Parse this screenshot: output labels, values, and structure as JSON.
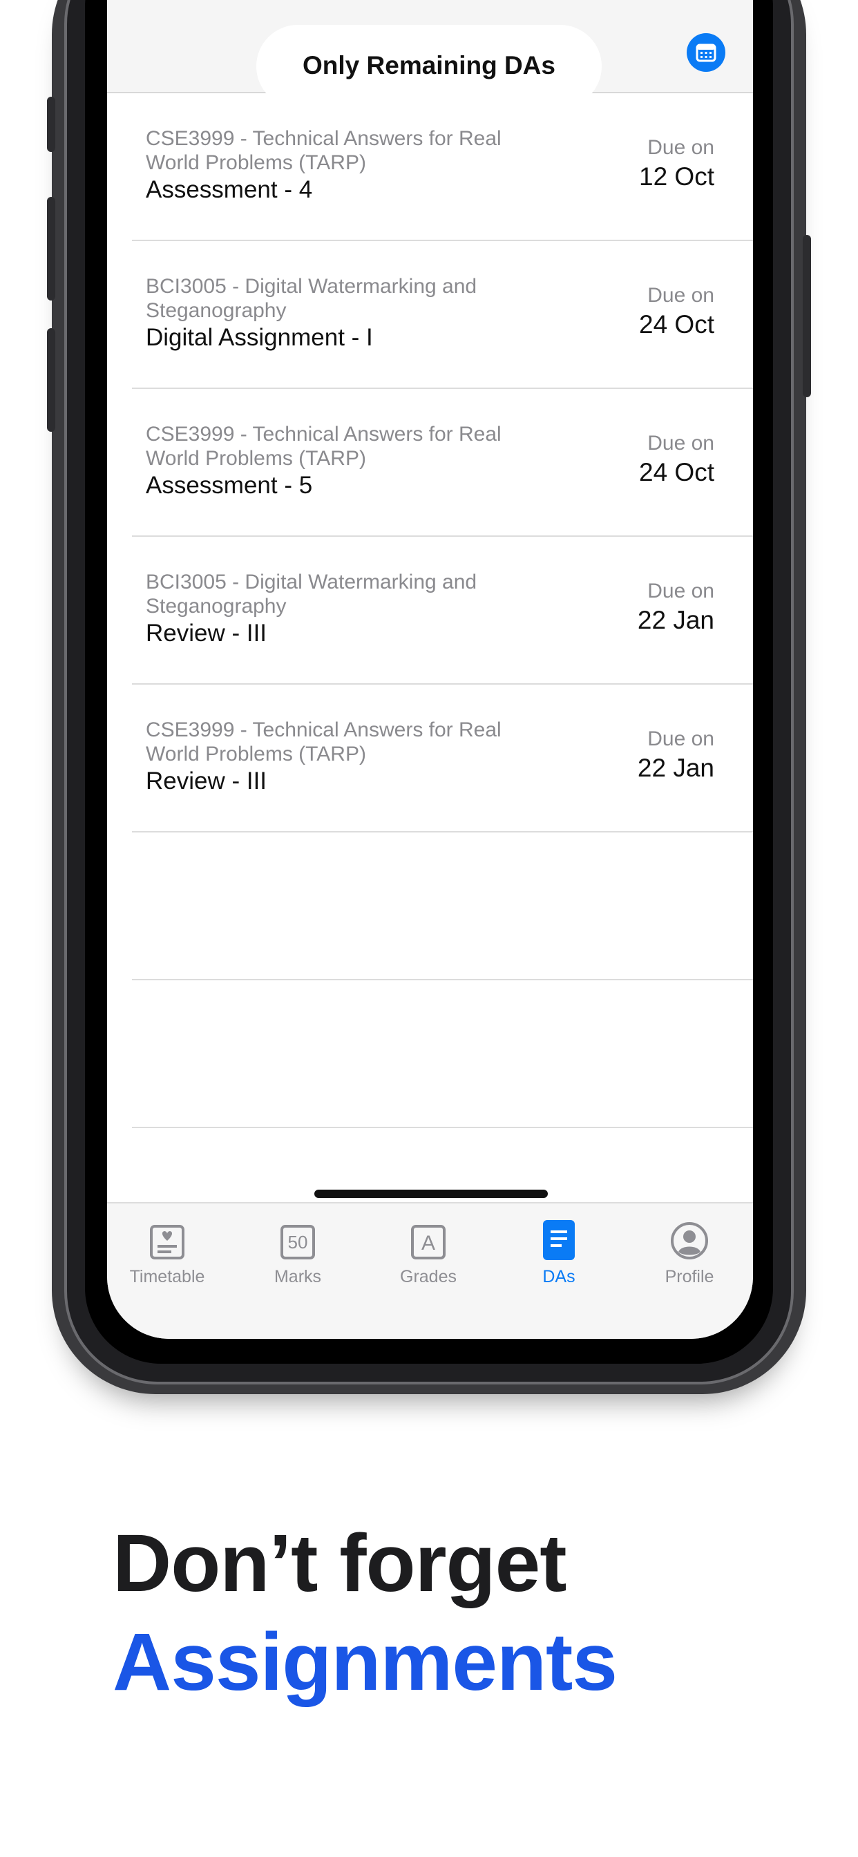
{
  "header": {
    "title": "Only Remaining DAs",
    "calendar_icon": "calendar-icon",
    "accent": "#0a7bf5"
  },
  "assignments": [
    {
      "course": "CSE3999 - Technical Answers for Real World Problems (TARP)",
      "name": "Assessment - 4",
      "due_label": "Due on",
      "due_date": "12 Oct"
    },
    {
      "course": "BCI3005 - Digital Watermarking and Steganography",
      "name": "Digital Assignment - I",
      "due_label": "Due on",
      "due_date": "24 Oct"
    },
    {
      "course": "CSE3999 - Technical Answers for Real World Problems (TARP)",
      "name": "Assessment - 5",
      "due_label": "Due on",
      "due_date": "24 Oct"
    },
    {
      "course": "BCI3005 - Digital Watermarking and Steganography",
      "name": "Review - III",
      "due_label": "Due on",
      "due_date": "22 Jan"
    },
    {
      "course": "CSE3999 - Technical Answers for Real World Problems (TARP)",
      "name": "Review - III",
      "due_label": "Due on",
      "due_date": "22 Jan"
    }
  ],
  "tabbar": {
    "tabs": [
      {
        "label": "Timetable",
        "icon": "timetable-icon"
      },
      {
        "label": "Marks",
        "icon": "marks-icon",
        "icon_text": "50"
      },
      {
        "label": "Grades",
        "icon": "grades-icon",
        "icon_text": "A"
      },
      {
        "label": "DAs",
        "icon": "das-icon",
        "active": true
      },
      {
        "label": "Profile",
        "icon": "profile-icon"
      }
    ]
  },
  "caption": {
    "line1": "Don’t forget",
    "line2": "Assignments",
    "line2_color": "#1a56e6"
  }
}
